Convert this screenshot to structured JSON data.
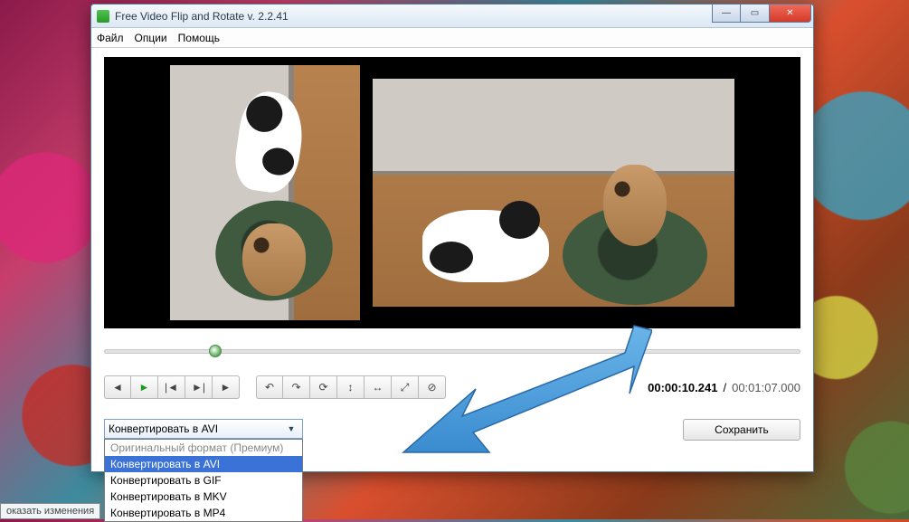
{
  "window": {
    "title": "Free Video Flip and Rotate v. 2.2.41"
  },
  "menu": {
    "file": "Файл",
    "options": "Опции",
    "help": "Помощь"
  },
  "playback": {
    "current_time": "00:00:10.241",
    "total_time": "00:01:07.000",
    "separator": "/"
  },
  "format_select": {
    "selected": "Конвертировать в AVI",
    "options": {
      "original": "Оригинальный формат (Премиум)",
      "avi": "Конвертировать в AVI",
      "gif": "Конвертировать в GIF",
      "mkv": "Конвертировать в MKV",
      "mp4": "Конвертировать в MP4"
    }
  },
  "buttons": {
    "save": "Сохранить"
  },
  "taskbar_hint": "оказать изменения",
  "icons": {
    "prev": "◄",
    "play": "►",
    "step_back": "|◄",
    "step_fwd": "►|",
    "next": "►",
    "rot_ccw": "↶",
    "rot_cw": "↷",
    "rot_180": "⟳",
    "flip_v": "↕",
    "flip_h": "↔",
    "expand": "⤢",
    "reset": "⊘",
    "dropdown": "▼",
    "minimize": "—",
    "maximize": "▭",
    "close": "✕"
  }
}
